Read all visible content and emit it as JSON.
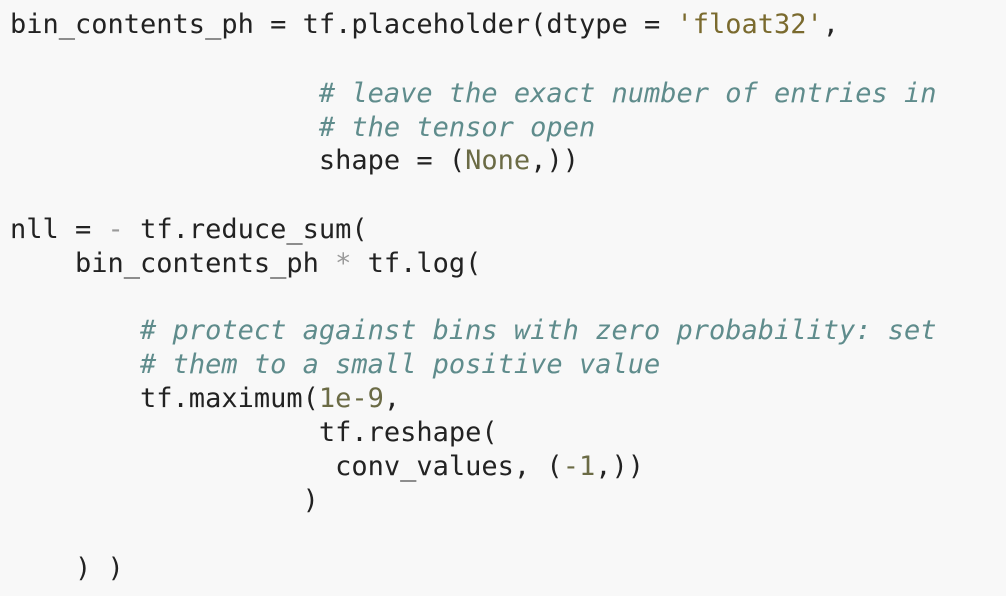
{
  "colors": {
    "background": "#f8f8f8",
    "text": "#222222",
    "comment": "#5f8c8c",
    "string": "#7a6a2e",
    "number": "#6b6b45",
    "operator": "#9a9a9a"
  },
  "code": {
    "lines": [
      [
        {
          "t": "bin_contents_ph = tf.placeholder(dtype = ",
          "c": "text"
        },
        {
          "t": "'float32'",
          "c": "string"
        },
        {
          "t": ",",
          "c": "text"
        }
      ],
      [],
      [
        {
          "t": "                   ",
          "c": "text"
        },
        {
          "t": "# leave the exact number of entries in",
          "c": "comment"
        }
      ],
      [
        {
          "t": "                   ",
          "c": "text"
        },
        {
          "t": "# the tensor open",
          "c": "comment"
        }
      ],
      [
        {
          "t": "                   shape = (",
          "c": "text"
        },
        {
          "t": "None",
          "c": "number"
        },
        {
          "t": ",))",
          "c": "text"
        }
      ],
      [],
      [
        {
          "t": "nll = ",
          "c": "text"
        },
        {
          "t": "-",
          "c": "operator"
        },
        {
          "t": " tf.reduce_sum(",
          "c": "text"
        }
      ],
      [
        {
          "t": "    bin_contents_ph ",
          "c": "text"
        },
        {
          "t": "*",
          "c": "operator"
        },
        {
          "t": " tf.log(",
          "c": "text"
        }
      ],
      [],
      [
        {
          "t": "        ",
          "c": "text"
        },
        {
          "t": "# protect against bins with zero probability: set",
          "c": "comment"
        }
      ],
      [
        {
          "t": "        ",
          "c": "text"
        },
        {
          "t": "# them to a small positive value",
          "c": "comment"
        }
      ],
      [
        {
          "t": "        tf.maximum(",
          "c": "text"
        },
        {
          "t": "1e-9",
          "c": "number"
        },
        {
          "t": ",",
          "c": "text"
        }
      ],
      [
        {
          "t": "                   tf.reshape(",
          "c": "text"
        }
      ],
      [
        {
          "t": "                    conv_values, (",
          "c": "text"
        },
        {
          "t": "-1",
          "c": "number"
        },
        {
          "t": ",))",
          "c": "text"
        }
      ],
      [
        {
          "t": "                  )",
          "c": "text"
        }
      ],
      [],
      [
        {
          "t": "    ) )",
          "c": "text"
        }
      ]
    ]
  }
}
